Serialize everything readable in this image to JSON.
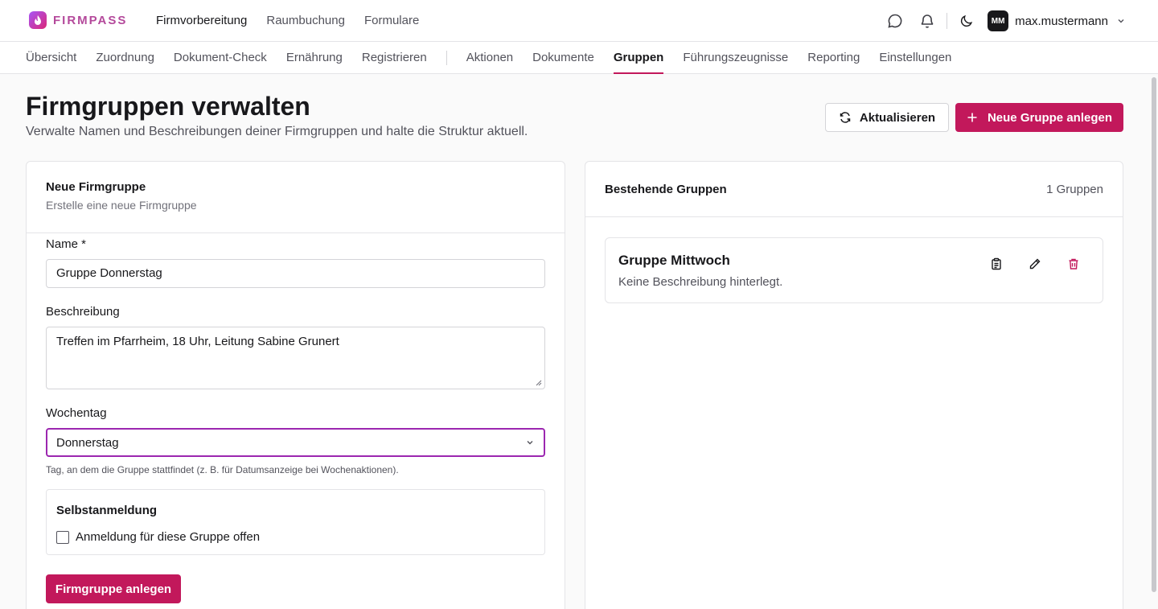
{
  "brand": {
    "name": "FIRMPASS"
  },
  "topnav": [
    {
      "label": "Firmvorbereitung",
      "active": true
    },
    {
      "label": "Raumbuchung",
      "active": false
    },
    {
      "label": "Formulare",
      "active": false
    }
  ],
  "user": {
    "initials": "MM",
    "name": "max.mustermann"
  },
  "subnav": [
    {
      "label": "Übersicht"
    },
    {
      "label": "Zuordnung"
    },
    {
      "label": "Dokument-Check"
    },
    {
      "label": "Ernährung"
    },
    {
      "label": "Registrieren"
    },
    {
      "label": "Aktionen"
    },
    {
      "label": "Dokumente"
    },
    {
      "label": "Gruppen",
      "active": true
    },
    {
      "label": "Führungszeugnisse"
    },
    {
      "label": "Reporting"
    },
    {
      "label": "Einstellungen"
    }
  ],
  "header": {
    "title": "Firmgruppen verwalten",
    "subtitle": "Verwalte Namen und Beschreibungen deiner Firmgruppen und halte die Struktur aktuell.",
    "refresh_label": "Aktualisieren",
    "new_group_label": "Neue Gruppe anlegen"
  },
  "form": {
    "title": "Neue Firmgruppe",
    "description": "Erstelle eine neue Firmgruppe",
    "name_label": "Name *",
    "name_value": "Gruppe Donnerstag",
    "description_label": "Beschreibung",
    "description_value": "Treffen im Pfarrheim, 18 Uhr, Leitung Sabine Grunert",
    "weekday_label": "Wochentag",
    "weekday_value": "Donnerstag",
    "weekday_hint": "Tag, an dem die Gruppe stattfindet (z. B. für Datumsanzeige bei Wochenaktionen).",
    "self_signup_title": "Selbstanmeldung",
    "self_signup_checkbox": "Anmeldung für diese Gruppe offen",
    "self_signup_checked": false,
    "submit_label": "Firmgruppe anlegen"
  },
  "existing": {
    "title": "Bestehende Gruppen",
    "count": "1 Gruppen",
    "groups": [
      {
        "name": "Gruppe Mittwoch",
        "description": "Keine Beschreibung hinterlegt."
      }
    ]
  },
  "colors": {
    "primary": "#c2185b",
    "select_focus": "#9c27b0",
    "delete": "#c2185b"
  }
}
